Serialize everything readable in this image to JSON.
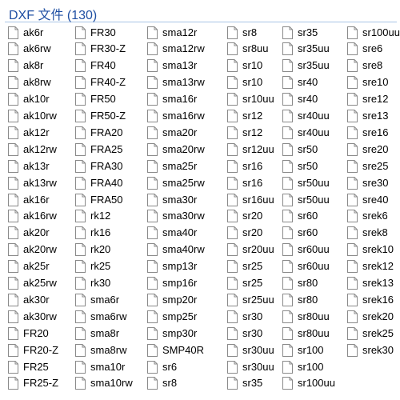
{
  "header": {
    "title": "DXF 文件 (130)"
  },
  "columns": [
    [
      "ak6r",
      "ak6rw",
      "ak8r",
      "ak8rw",
      "ak10r",
      "ak10rw",
      "ak12r",
      "ak12rw",
      "ak13r",
      "ak13rw",
      "ak16r",
      "ak16rw",
      "ak20r",
      "ak20rw",
      "ak25r",
      "ak25rw",
      "ak30r",
      "ak30rw",
      "FR20",
      "FR20-Z",
      "FR25",
      "FR25-Z"
    ],
    [
      "FR30",
      "FR30-Z",
      "FR40",
      "FR40-Z",
      "FR50",
      "FR50-Z",
      "FRA20",
      "FRA25",
      "FRA30",
      "FRA40",
      "FRA50",
      "rk12",
      "rk16",
      "rk20",
      "rk25",
      "rk30",
      "sma6r",
      "sma6rw",
      "sma8r",
      "sma8rw",
      "sma10r",
      "sma10rw"
    ],
    [
      "sma12r",
      "sma12rw",
      "sma13r",
      "sma13rw",
      "sma16r",
      "sma16rw",
      "sma20r",
      "sma20rw",
      "sma25r",
      "sma25rw",
      "sma30r",
      "sma30rw",
      "sma40r",
      "sma40rw",
      "smp13r",
      "smp16r",
      "smp20r",
      "smp25r",
      "smp30r",
      "SMP40R",
      "sr6",
      "sr8"
    ],
    [
      "sr8",
      "sr8uu",
      "sr10",
      "sr10",
      "sr10uu",
      "sr12",
      "sr12",
      "sr12uu",
      "sr16",
      "sr16",
      "sr16uu",
      "sr20",
      "sr20",
      "sr20uu",
      "sr25",
      "sr25",
      "sr25uu",
      "sr30",
      "sr30",
      "sr30uu",
      "sr30uu",
      "sr35"
    ],
    [
      "sr35",
      "sr35uu",
      "sr35uu",
      "sr40",
      "sr40",
      "sr40uu",
      "sr40uu",
      "sr50",
      "sr50",
      "sr50uu",
      "sr50uu",
      "sr60",
      "sr60",
      "sr60uu",
      "sr60uu",
      "sr80",
      "sr80",
      "sr80uu",
      "sr80uu",
      "sr100",
      "sr100",
      "sr100uu"
    ],
    [
      "sr100uu",
      "sre6",
      "sre8",
      "sre10",
      "sre12",
      "sre13",
      "sre16",
      "sre20",
      "sre25",
      "sre30",
      "sre40",
      "srek6",
      "srek8",
      "srek10",
      "srek12",
      "srek13",
      "srek16",
      "srek20",
      "srek25",
      "srek30"
    ]
  ]
}
